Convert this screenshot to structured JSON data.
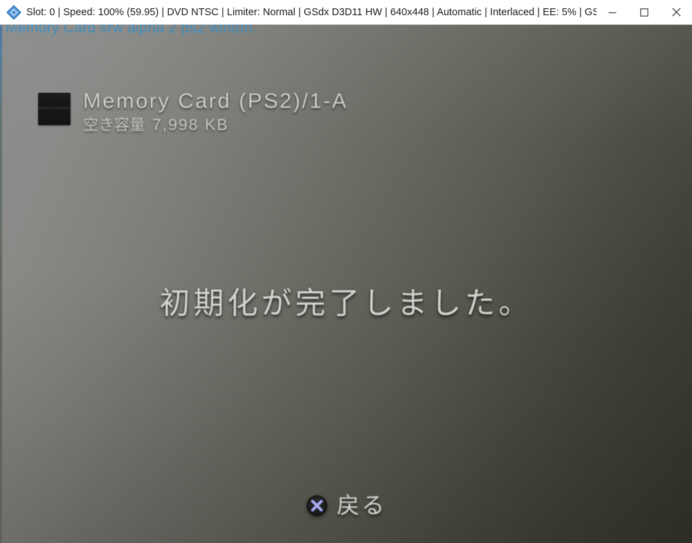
{
  "window": {
    "icon_name": "pcsx2-logo-icon",
    "title": "Slot: 0 | Speed: 100% (59.95) | DVD NTSC | Limiter: Normal | GSdx D3D11 HW | 640x448 | Automatic | Interlaced | EE:  5% | GS:  …",
    "controls": {
      "minimize_label": "Minimize",
      "maximize_label": "Maximize",
      "close_label": "Close"
    }
  },
  "overlay": {
    "caption": "Memory Card srw alpha 2 ps2 winton."
  },
  "memory_card": {
    "icon_name": "memory-card-icon",
    "title": "Memory Card (PS2)/1-A",
    "free_space_label": "空き容量",
    "free_space_value": "7,998 KB"
  },
  "status": {
    "message": "初期化が完了しました。"
  },
  "prompt": {
    "button_icon_name": "playstation-cross-button-icon",
    "label": "戻る"
  },
  "colors": {
    "title_bar_bg": "#ffffff",
    "title_text": "#1b1b1b",
    "overlay_caption": "#3d8ec0",
    "viewport_gradient_start": "#8e8e8e",
    "viewport_gradient_end": "#33342a",
    "game_text": "#d5d5d0",
    "cross_button_glyph": "#8e92e0"
  },
  "metrics": {
    "resolution": "640x448",
    "speed_percent": "100%",
    "fps": "59.95",
    "ee_percent": "5%",
    "slot": "0"
  }
}
